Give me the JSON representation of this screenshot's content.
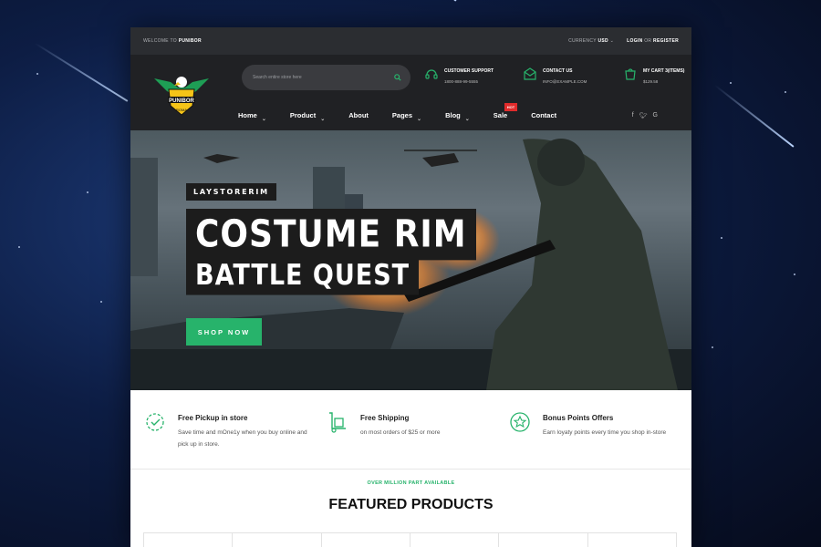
{
  "topbar": {
    "welcome": "WELCOME TO",
    "store": "PUNIBOR",
    "currency_label": "CURRENCY",
    "currency_value": "USD",
    "login": "LOGIN",
    "or": "OR",
    "register": "REGISTER"
  },
  "logo": {
    "text": "PUNIBOR",
    "sub": "ROMA"
  },
  "search": {
    "placeholder": "Search entire store here"
  },
  "support": {
    "title": "CUSTOMER SUPPORT",
    "value": "1800-888-99-5555"
  },
  "contact": {
    "title": "CONTACT US",
    "value": "INFO@EXAMPLE.COM"
  },
  "cart": {
    "title": "MY CART 3(ITEMS)",
    "value": "$129.58"
  },
  "nav": {
    "items": [
      {
        "label": "Home"
      },
      {
        "label": "Product"
      },
      {
        "label": "About"
      },
      {
        "label": "Pages"
      },
      {
        "label": "Blog"
      },
      {
        "label": "Sale"
      },
      {
        "label": "Contact"
      }
    ],
    "hot_badge": "HOT"
  },
  "hero": {
    "tagline": "LAYSTORERIM",
    "title1": "COSTUME RIM",
    "title2": "BATTLE QUEST",
    "cta": "SHOP NOW"
  },
  "features": [
    {
      "title": "Free Pickup in store",
      "desc": "Save time and mOne1y when you buy online and pick up in store."
    },
    {
      "title": "Free Shipping",
      "desc": "on most orders of $25 or more"
    },
    {
      "title": "Bonus Points Offers",
      "desc": "Earn loyaty points every time you shop in-store"
    }
  ],
  "section": {
    "subtitle": "OVER MILLION PART AVAILABLE",
    "title": "FEATURED PRODUCTS"
  },
  "colors": {
    "accent": "#27b36b",
    "dark": "#202124",
    "hot": "#e02b2b"
  }
}
